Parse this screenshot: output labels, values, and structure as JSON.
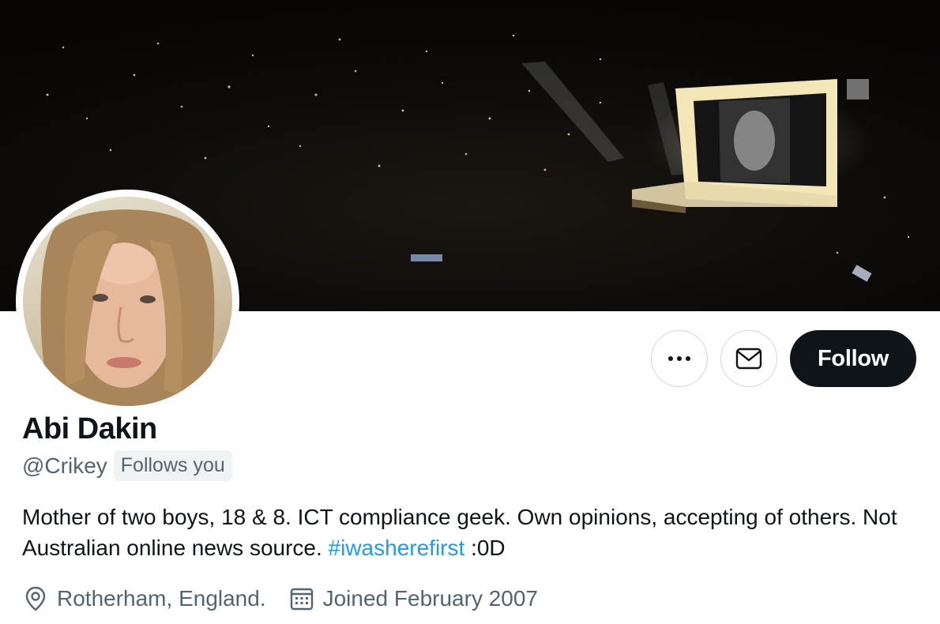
{
  "profile": {
    "name": "Abi Dakin",
    "handle": "@Crikey",
    "follows_you": "Follows you",
    "bio_text": "Mother of two boys, 18 & 8. ICT compliance geek. Own opinions, accepting of others. Not Australian online news source.",
    "bio_hashtag": "#iwasherefirst",
    "bio_suffix": ":0D",
    "location": "Rotherham, England.",
    "joined": "Joined February 2007"
  },
  "actions": {
    "more_icon": "more-horizontal-icon",
    "message_icon": "envelope-icon",
    "follow_label": "Follow"
  },
  "icons": {
    "location": "map-pin-icon",
    "joined": "calendar-icon"
  },
  "colors": {
    "link": "#1d9bf0",
    "text_primary": "#0f1419",
    "text_secondary": "#536471",
    "follow_button_bg": "#0f1419"
  }
}
